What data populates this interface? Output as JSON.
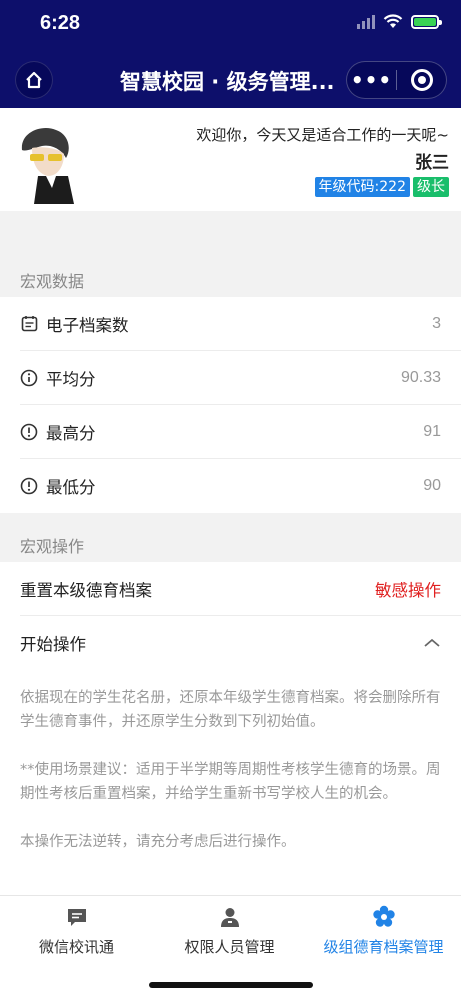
{
  "status_bar": {
    "time": "6:28"
  },
  "nav": {
    "title": "智慧校园 · 级务管理..."
  },
  "profile": {
    "greeting": "欢迎你，今天又是适合工作的一天呢~",
    "name": "张三",
    "grade_code": "年级代码:222",
    "role": "级长"
  },
  "macro_data": {
    "title": "宏观数据",
    "rows": [
      {
        "icon": "calendar-icon",
        "label": "电子档案数",
        "value": "3"
      },
      {
        "icon": "info-circle-icon",
        "label": "平均分",
        "value": "90.33"
      },
      {
        "icon": "alert-circle-icon",
        "label": "最高分",
        "value": "91"
      },
      {
        "icon": "alert-circle-icon",
        "label": "最低分",
        "value": "90"
      }
    ]
  },
  "macro_ops": {
    "title": "宏观操作",
    "reset_label": "重置本级德育档案",
    "reset_badge": "敏感操作",
    "start_label": "开始操作",
    "description": [
      "依据现在的学生花名册，还原本年级学生德育档案。将会删除所有学生德育事件，并还原学生分数到下列初始值。",
      "**使用场景建议：适用于半学期等周期性考核学生德育的场景。周期性考核后重置档案，并给学生重新书写学校人生的机会。",
      "本操作无法逆转，请充分考虑后进行操作。"
    ]
  },
  "tabbar": {
    "tabs": [
      {
        "label": "微信校讯通",
        "icon": "message-icon"
      },
      {
        "label": "权限人员管理",
        "icon": "person-icon"
      },
      {
        "label": "级组德育档案管理",
        "icon": "gear-flower-icon"
      }
    ],
    "active_index": 2
  },
  "colors": {
    "nav_bg": "#0d0f6b",
    "accent": "#2183e6",
    "danger": "#e02020",
    "green": "#19be6b"
  }
}
